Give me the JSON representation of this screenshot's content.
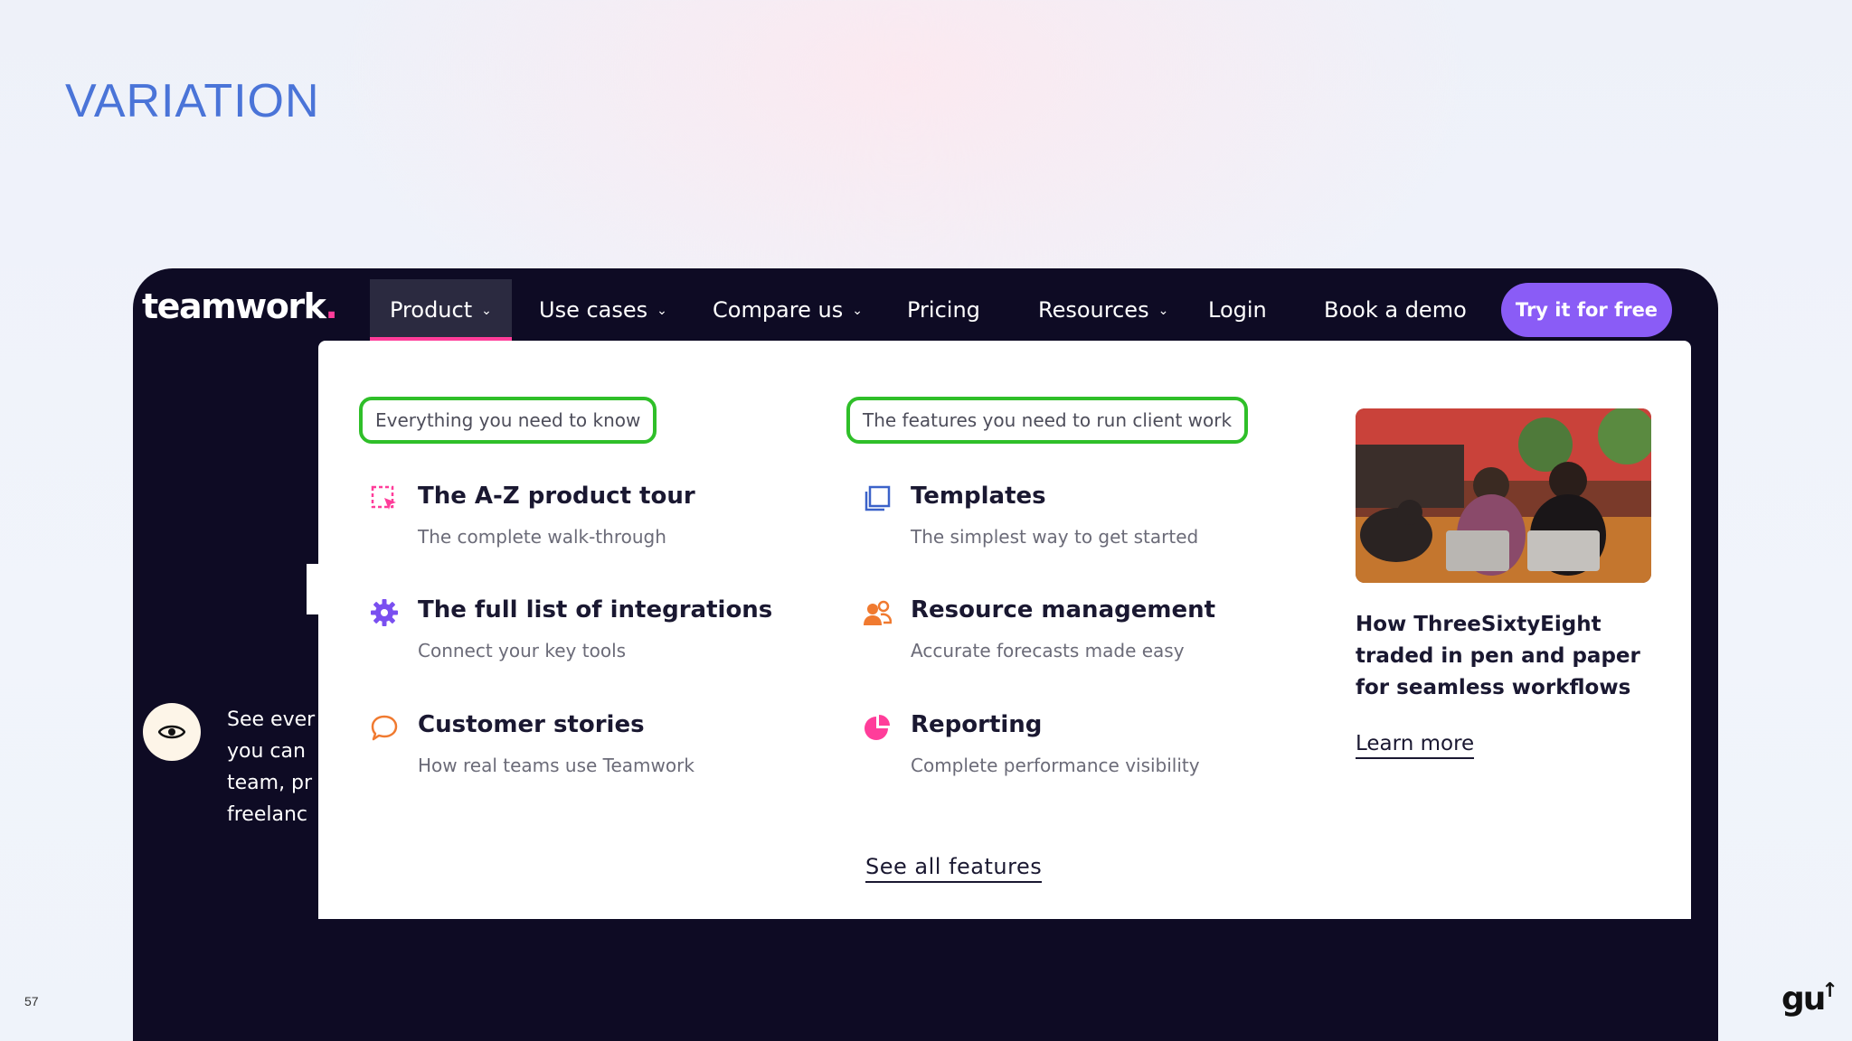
{
  "slide": {
    "title": "VARIATION",
    "page_number": "57",
    "brand_mark": "gu"
  },
  "nav": {
    "logo_text": "teamwork",
    "logo_dot": ".",
    "items": [
      {
        "label": "Product",
        "has_dropdown": true,
        "active": true
      },
      {
        "label": "Use cases",
        "has_dropdown": true
      },
      {
        "label": "Compare us",
        "has_dropdown": true
      },
      {
        "label": "Pricing",
        "has_dropdown": false
      },
      {
        "label": "Resources",
        "has_dropdown": true
      },
      {
        "label": "Login",
        "has_dropdown": false
      },
      {
        "label": "Book a demo",
        "has_dropdown": false
      }
    ],
    "cta_label": "Try it for free",
    "accent_color": "#ff3d9a",
    "cta_color": "#8a5cf6"
  },
  "hero": {
    "text_lines": [
      "See ever",
      "you can",
      "team, pr",
      "freelanc"
    ]
  },
  "dropdown": {
    "left_column": {
      "heading": "Everything you need to know",
      "items": [
        {
          "icon": "cursor-select-icon",
          "title": "The A-Z product tour",
          "subtitle": "The complete walk-through"
        },
        {
          "icon": "gear-icon",
          "title": "The full list of integrations",
          "subtitle": "Connect your key tools"
        },
        {
          "icon": "speech-bubble-icon",
          "title": "Customer stories",
          "subtitle": "How real teams use Teamwork"
        }
      ]
    },
    "middle_column": {
      "heading": "The features you need to run client work",
      "items": [
        {
          "icon": "templates-icon",
          "title": "Templates",
          "subtitle": "The simplest way to get started"
        },
        {
          "icon": "people-icon",
          "title": "Resource management",
          "subtitle": "Accurate forecasts made easy"
        },
        {
          "icon": "pie-chart-icon",
          "title": "Reporting",
          "subtitle": "Complete performance visibility"
        }
      ]
    },
    "promo": {
      "title": "How ThreeSixtyEight traded in pen and paper for seamless workflows",
      "link_label": "Learn more"
    },
    "see_all_label": "See all features",
    "highlight_color": "#2fbf29"
  }
}
